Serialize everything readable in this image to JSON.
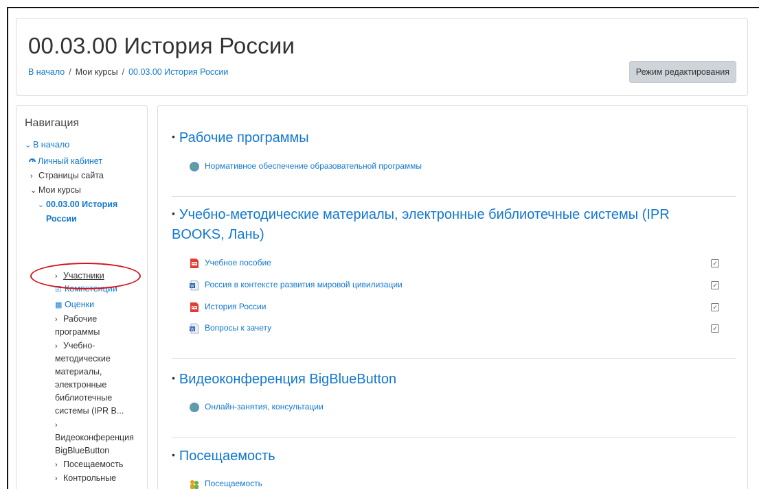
{
  "header": {
    "title": "00.03.00 История России",
    "breadcrumb": [
      "В начало",
      "Мои курсы",
      "00.03.00 История России"
    ],
    "edit_button": "Режим редактирования"
  },
  "navigation": {
    "title": "Навигация",
    "items": [
      {
        "label": "В начало",
        "chevron": "⌄"
      },
      {
        "label": "Личный кабинет",
        "icon": "dashboard-icon"
      },
      {
        "label": "Страницы сайта",
        "chevron": "›"
      },
      {
        "label": "Мои курсы",
        "chevron": "⌄"
      },
      {
        "label": "00.03.00 История",
        "chevron": "⌄"
      },
      {
        "label": "России"
      },
      {
        "label": "Участники",
        "chevron": "›"
      },
      {
        "label": "Компетенции",
        "icon": "checkbox-icon"
      },
      {
        "label": "Оценки",
        "icon": "table-icon"
      },
      {
        "label": "Рабочие",
        "chevron": "›"
      },
      {
        "label": "программы"
      },
      {
        "label": "Учебно-",
        "chevron": "›"
      },
      {
        "label": "методические"
      },
      {
        "label": "материалы,"
      },
      {
        "label": "электронные"
      },
      {
        "label": "библиотечные"
      },
      {
        "label": "системы (IPR B..."
      },
      {
        "label": "",
        "chevron": "›"
      },
      {
        "label": "Видеоконференция"
      },
      {
        "label": "BigBlueButton"
      },
      {
        "label": "Посещаемость",
        "chevron": "›"
      },
      {
        "label": "Контрольные",
        "chevron": "›"
      }
    ]
  },
  "sections": [
    {
      "title": "Рабочие программы",
      "activities": [
        {
          "label": "Нормативное обеспечение образовательной программы",
          "icon": "url-globe-icon",
          "checkbox": false
        }
      ]
    },
    {
      "title_line1": "Учебно-методические материалы, электронные библиотечные системы (IPR",
      "title_line2": "BOOKS, Лань)",
      "activities": [
        {
          "label": "Учебное пособие",
          "icon": "pdf-icon",
          "checkbox": true
        },
        {
          "label": "Россия в контексте развития мировой цивилизации",
          "icon": "word-doc-icon",
          "checkbox": true
        },
        {
          "label": "История России",
          "icon": "pdf-icon",
          "checkbox": true
        },
        {
          "label": "Вопросы к зачету",
          "icon": "word-doc-icon",
          "checkbox": true
        }
      ]
    },
    {
      "title": "Видеоконференция BigBlueButton",
      "activities": [
        {
          "label": "Онлайн-занятия, консультации",
          "icon": "url-globe-icon",
          "checkbox": false
        }
      ]
    },
    {
      "title": "Посещаемость",
      "activities": [
        {
          "label": "Посещаемость",
          "icon": "attendance-icon",
          "checkbox": false
        }
      ]
    }
  ],
  "colors": {
    "link": "#1177d1",
    "highlight": "#d4141b",
    "button_bg": "#ced4da"
  }
}
